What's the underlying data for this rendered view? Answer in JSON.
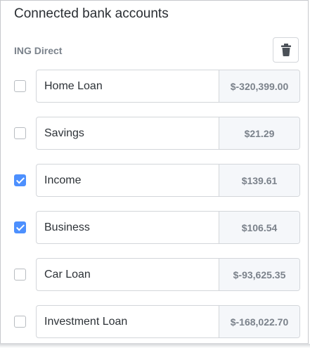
{
  "header": {
    "title": "Connected bank accounts"
  },
  "bank": {
    "name": "ING Direct",
    "delete_icon": "trash-icon"
  },
  "accounts": [
    {
      "name": "Home Loan",
      "amount": "$-320,399.00",
      "checked": false
    },
    {
      "name": "Savings",
      "amount": "$21.29",
      "checked": false
    },
    {
      "name": "Income",
      "amount": "$139.61",
      "checked": true
    },
    {
      "name": "Business",
      "amount": "$106.54",
      "checked": true
    },
    {
      "name": "Car Loan",
      "amount": "$-93,625.35",
      "checked": false
    },
    {
      "name": "Investment Loan",
      "amount": "$-168,022.70",
      "checked": false
    }
  ],
  "colors": {
    "checked": "#4d90fe",
    "border": "#d3d6da",
    "amount_bg": "#f5f7fa",
    "muted_text": "#7b828b"
  }
}
